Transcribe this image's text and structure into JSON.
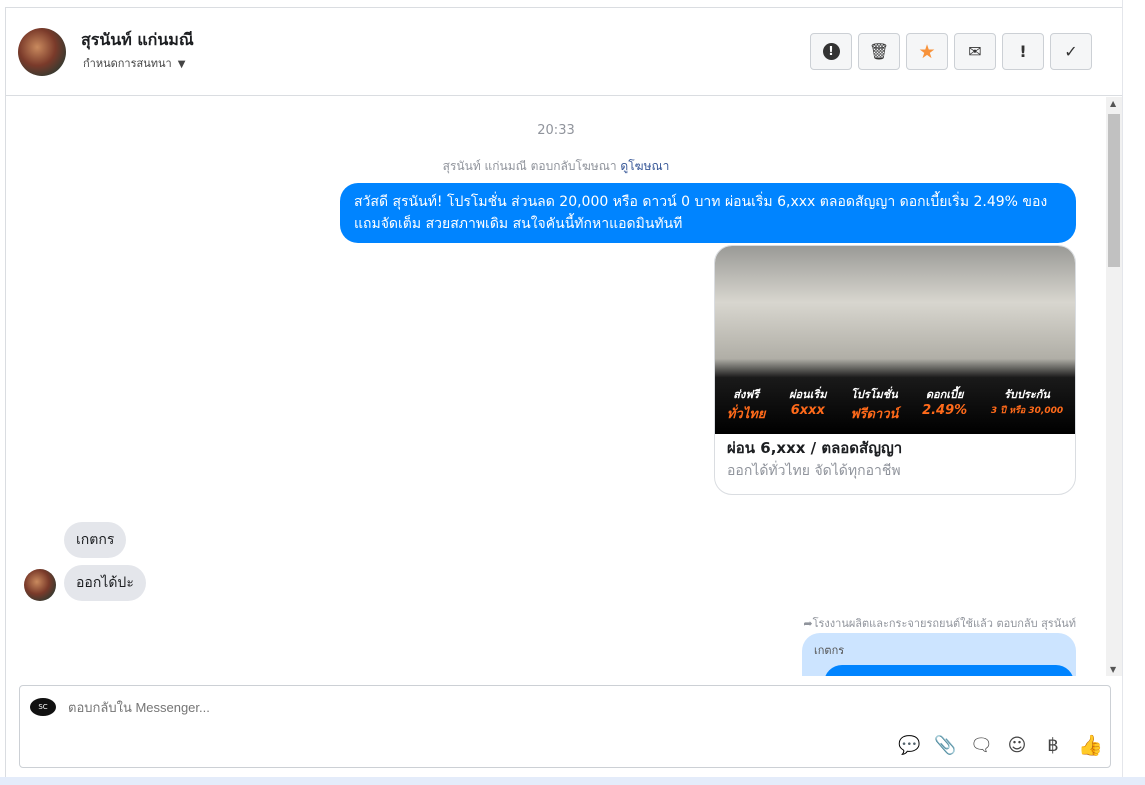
{
  "header": {
    "name": "สุรนันท์ แก่นมณี",
    "subtitle": "กำหนดการสนทนา",
    "actions": [
      {
        "name": "report",
        "glyph": "!"
      },
      {
        "name": "delete",
        "glyph": "🗑"
      },
      {
        "name": "star",
        "glyph": "★"
      },
      {
        "name": "mail",
        "glyph": "✉"
      },
      {
        "name": "important",
        "glyph": "!"
      },
      {
        "name": "done",
        "glyph": "✓"
      }
    ]
  },
  "chat": {
    "time": "20:33",
    "reply_info": "สุรนันท์ แก่นมณี ตอบกลับโฆษณา",
    "reply_link": "ดูโฆษณา",
    "outgoing": "สวัสดี สุรนันท์! โปรโมชั่น ส่วนลด 20,000 หรือ ดาวน์ 0 บาท ผ่อนเริ่ม 6,xxx ตลอดสัญญา ดอกเบี้ยเริ่ม 2.49% ของแถมจัดเต็ม สวยสภาพเดิม สนใจคันนี้ทักหาแอดมินทันที",
    "card": {
      "title": "ผ่อน 6,xxx / ตลอดสัญญา",
      "desc": "ออกได้ทั่วไทย จัดได้ทุกอาชีพ",
      "promo": [
        {
          "t": "ส่งฟรี",
          "v": "ทั่วไทย"
        },
        {
          "t": "ผ่อนเริ่ม",
          "v": "6xxx"
        },
        {
          "t": "โปรโมชั่น",
          "v": "ฟรีดาวน์"
        },
        {
          "t": "ดอกเบี้ย",
          "v": "2.49%"
        },
        {
          "t": "รับประกัน",
          "v": "3 ปี หรือ 30,000"
        }
      ]
    },
    "incoming": [
      "เกตกร",
      "ออกได้ปะ"
    ],
    "forward_info": "โรงงานผลิตและกระจายรถยนต์ใช้แล้ว ตอบกลับ สุรนันท์",
    "quote_label": "เกตกร"
  },
  "composer": {
    "placeholder": "ตอบกลับใน Messenger...",
    "logo": "SC"
  },
  "colors": {
    "accent": "#0084ff",
    "star": "#f7923b"
  }
}
